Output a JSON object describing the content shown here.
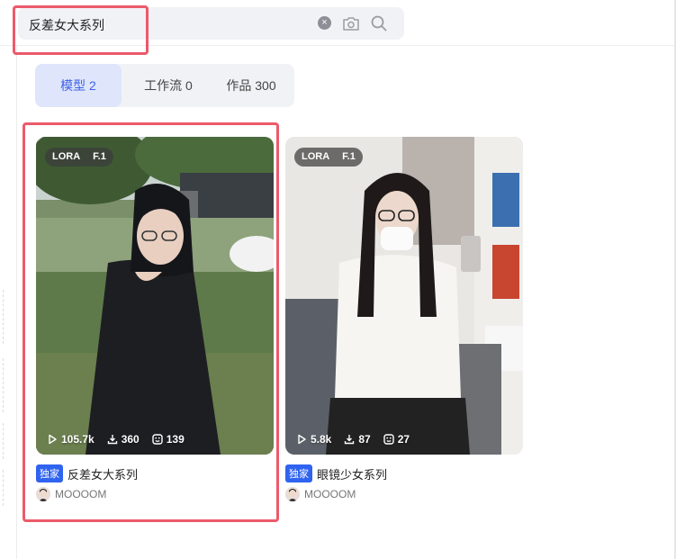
{
  "search": {
    "query": "反差女大系列"
  },
  "tabs": [
    {
      "label": "模型 2",
      "active": true
    },
    {
      "label": "工作流 0",
      "active": false
    },
    {
      "label": "作品 300",
      "active": false
    }
  ],
  "cards": [
    {
      "badges": [
        "LORA",
        "F.1"
      ],
      "plays": "105.7k",
      "downloads": "360",
      "images": "139",
      "tag": "独家",
      "title": "反差女大系列",
      "author": "MOOOOM"
    },
    {
      "badges": [
        "LORA",
        "F.1"
      ],
      "plays": "5.8k",
      "downloads": "87",
      "images": "27",
      "tag": "独家",
      "title": "眼镜少女系列",
      "author": "MOOOOM"
    }
  ],
  "colors": {
    "accent": "#3d62e6",
    "tag": "#2f63f0",
    "highlight": "#ec5a6b"
  }
}
